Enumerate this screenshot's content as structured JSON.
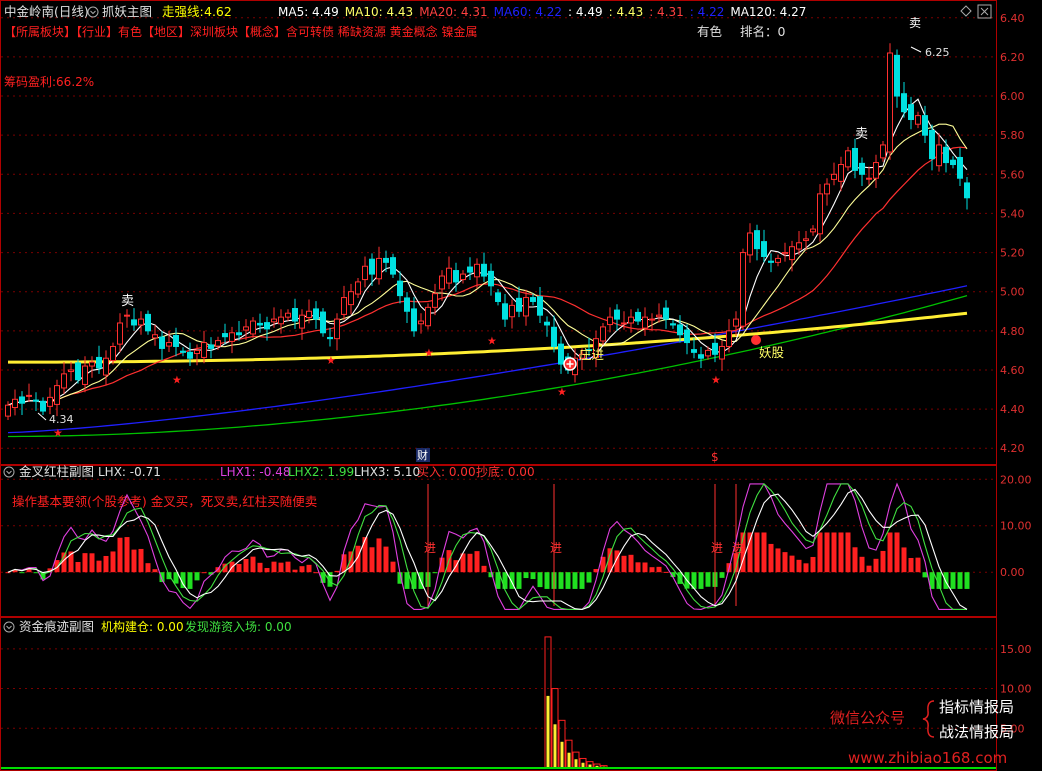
{
  "main": {
    "stock": "中金岭南(日线)",
    "indicator": "抓妖主图",
    "strong_label": "走强线:",
    "strong_value": "4.62",
    "ma": [
      {
        "label": "MA5: 4.49",
        "color": "#ffffff"
      },
      {
        "label": "MA10: 4.43",
        "color": "#ffff66"
      },
      {
        "label": "MA20: 4.31",
        "color": "#ff4040"
      },
      {
        "label": "MA60: 4.22",
        "color": "#2020ff"
      },
      {
        "label": ": 4.49",
        "color": "#ffffff"
      },
      {
        "label": ": 4.43",
        "color": "#ffff66"
      },
      {
        "label": ": 4.31",
        "color": "#ff4040"
      },
      {
        "label": ": 4.22",
        "color": "#2020ff"
      },
      {
        "label": "MA120: 4.27",
        "color": "#ffffff"
      }
    ],
    "concepts": "【所属板块】【行业】有色【地区】深圳板块【概念】含可转债 稀缺资源 黄金概念 镍金属",
    "industry": "有色",
    "rank": "排名：0",
    "profit": "筹码盈利:66.2%",
    "y_ticks": [
      "6.40",
      "6.20",
      "6.00",
      "5.80",
      "5.60",
      "5.40",
      "5.20",
      "5.00",
      "4.80",
      "4.60",
      "4.40",
      "4.20"
    ],
    "y_range": [
      4.15,
      6.45
    ],
    "annotations": {
      "low_price": "4.34",
      "high_price": "6.25",
      "sell1": "卖",
      "sell2": "卖",
      "sell_top": "卖",
      "zhuang": "庄进",
      "yao": "妖股",
      "cai": "财",
      "dollar": "$"
    }
  },
  "sub1": {
    "title": "金叉红柱副图",
    "lhx": "LHX: -0.71",
    "lhx1": "LHX1: -0.48",
    "lhx2": "LHX2: 1.99",
    "lhx3": "LHX3: 5.10",
    "buy": "买入: 0.00",
    "dip": "抄底: 0.00",
    "note": "操作基本要领(个股参考) 金叉买，死叉卖,红柱买随便卖",
    "jin": "进",
    "y_ticks": [
      "20.00",
      "10.00",
      "0.00"
    ],
    "y_range": [
      -9,
      22
    ]
  },
  "sub2": {
    "title": "资金痕迹副图",
    "jg": "机构建仓: 0.00",
    "fx": "发现游资入场: 0.00",
    "y_ticks": [
      "15.00",
      "10.00",
      "5.00"
    ],
    "y_range": [
      0,
      18
    ]
  },
  "watermark": {
    "wechat": "微信公众号",
    "line1": "指标情报局",
    "line2": "战法情报局",
    "url": "www.zhibiao168.com"
  },
  "chart_data": {
    "type": "candlestick",
    "bars": 138,
    "closes": [
      4.42,
      4.45,
      4.43,
      4.47,
      4.44,
      4.39,
      4.46,
      4.52,
      4.58,
      4.6,
      4.55,
      4.62,
      4.64,
      4.61,
      4.66,
      4.72,
      4.84,
      4.88,
      4.83,
      4.86,
      4.8,
      4.78,
      4.71,
      4.74,
      4.72,
      4.69,
      4.66,
      4.7,
      4.74,
      4.71,
      4.75,
      4.77,
      4.79,
      4.78,
      4.82,
      4.85,
      4.83,
      4.81,
      4.86,
      4.87,
      4.89,
      4.85,
      4.88,
      4.9,
      4.86,
      4.79,
      4.76,
      4.86,
      4.97,
      5.0,
      5.05,
      5.13,
      5.09,
      5.17,
      5.15,
      5.09,
      4.98,
      4.9,
      4.8,
      4.85,
      4.92,
      4.99,
      5.08,
      5.12,
      5.05,
      5.09,
      5.1,
      5.14,
      5.08,
      5.03,
      4.95,
      4.86,
      4.93,
      4.9,
      4.97,
      4.95,
      4.88,
      4.83,
      4.72,
      4.63,
      4.6,
      4.66,
      4.68,
      4.7,
      4.76,
      4.82,
      4.87,
      4.86,
      4.84,
      4.87,
      4.85,
      4.87,
      4.86,
      4.88,
      4.86,
      4.83,
      4.78,
      4.74,
      4.69,
      4.66,
      4.7,
      4.68,
      4.72,
      4.8,
      4.86,
      5.2,
      5.3,
      5.22,
      5.18,
      5.15,
      5.17,
      5.2,
      5.23,
      5.25,
      5.27,
      5.32,
      5.5,
      5.55,
      5.6,
      5.65,
      5.72,
      5.62,
      5.6,
      5.58,
      5.66,
      5.75,
      6.22,
      6.0,
      5.92,
      5.88,
      5.9,
      5.8,
      5.68,
      5.75,
      5.66,
      5.65,
      5.58,
      5.48
    ],
    "ma_values": {
      "MA5": 4.49,
      "MA10": 4.43,
      "MA20": 4.31,
      "MA60": 4.22,
      "MA120": 4.27
    },
    "strong_line": 4.62,
    "lhx": -0.71,
    "lhx1": -0.48,
    "lhx2": 1.99,
    "lhx3": 5.1,
    "fund_bars": [
      16.5,
      10.0,
      6.0,
      3.5,
      2.0,
      1.2,
      0.8,
      0.5,
      0.3
    ]
  }
}
